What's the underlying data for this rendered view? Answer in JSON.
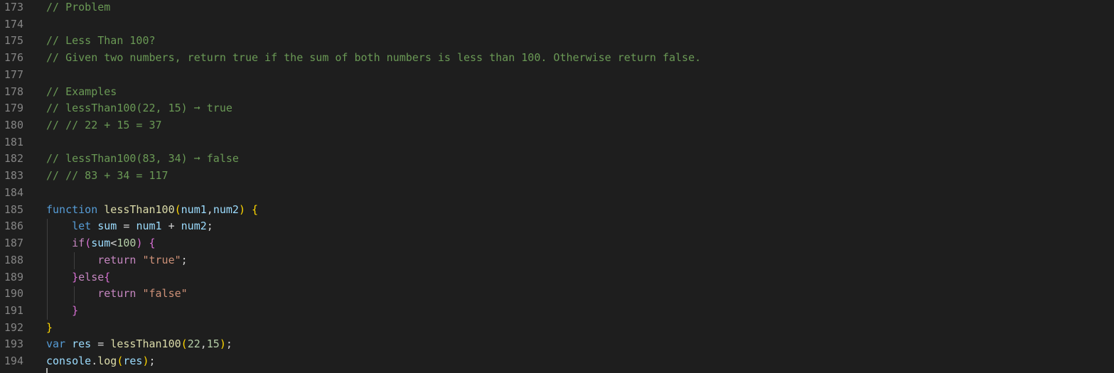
{
  "editor": {
    "lines": [
      {
        "num": "173",
        "tokens": [
          {
            "t": "// Problem",
            "c": "comment"
          }
        ]
      },
      {
        "num": "174",
        "tokens": []
      },
      {
        "num": "175",
        "tokens": [
          {
            "t": "// Less Than 100?",
            "c": "comment"
          }
        ]
      },
      {
        "num": "176",
        "tokens": [
          {
            "t": "// Given two numbers, return true if the sum of both numbers is less than 100. Otherwise return false.",
            "c": "comment"
          }
        ]
      },
      {
        "num": "177",
        "tokens": []
      },
      {
        "num": "178",
        "tokens": [
          {
            "t": "// Examples",
            "c": "comment"
          }
        ]
      },
      {
        "num": "179",
        "tokens": [
          {
            "t": "// lessThan100(22, 15) ➞ true",
            "c": "comment"
          }
        ]
      },
      {
        "num": "180",
        "tokens": [
          {
            "t": "// // 22 + 15 = 37",
            "c": "comment"
          }
        ]
      },
      {
        "num": "181",
        "tokens": []
      },
      {
        "num": "182",
        "tokens": [
          {
            "t": "// lessThan100(83, 34) ➞ false",
            "c": "comment"
          }
        ]
      },
      {
        "num": "183",
        "tokens": [
          {
            "t": "// // 83 + 34 = 117",
            "c": "comment"
          }
        ]
      },
      {
        "num": "184",
        "tokens": []
      },
      {
        "num": "185",
        "tokens": [
          {
            "t": "function",
            "c": "kw"
          },
          {
            "t": " ",
            "c": "plain"
          },
          {
            "t": "lessThan100",
            "c": "fn"
          },
          {
            "t": "(",
            "c": "b1"
          },
          {
            "t": "num1",
            "c": "var"
          },
          {
            "t": ",",
            "c": "plain"
          },
          {
            "t": "num2",
            "c": "var"
          },
          {
            "t": ")",
            "c": "b1"
          },
          {
            "t": " ",
            "c": "plain"
          },
          {
            "t": "{",
            "c": "b1"
          }
        ]
      },
      {
        "num": "186",
        "tokens": [
          {
            "t": "    ",
            "c": "plain"
          },
          {
            "t": "let",
            "c": "kw"
          },
          {
            "t": " ",
            "c": "plain"
          },
          {
            "t": "sum",
            "c": "var"
          },
          {
            "t": " = ",
            "c": "plain"
          },
          {
            "t": "num1",
            "c": "var"
          },
          {
            "t": " + ",
            "c": "plain"
          },
          {
            "t": "num2",
            "c": "var"
          },
          {
            "t": ";",
            "c": "plain"
          }
        ]
      },
      {
        "num": "187",
        "tokens": [
          {
            "t": "    ",
            "c": "plain"
          },
          {
            "t": "if",
            "c": "ctrl"
          },
          {
            "t": "(",
            "c": "b2"
          },
          {
            "t": "sum",
            "c": "var"
          },
          {
            "t": "<",
            "c": "plain"
          },
          {
            "t": "100",
            "c": "num"
          },
          {
            "t": ")",
            "c": "b2"
          },
          {
            "t": " ",
            "c": "plain"
          },
          {
            "t": "{",
            "c": "b2"
          }
        ]
      },
      {
        "num": "188",
        "tokens": [
          {
            "t": "        ",
            "c": "plain"
          },
          {
            "t": "return",
            "c": "ctrl"
          },
          {
            "t": " ",
            "c": "plain"
          },
          {
            "t": "\"true\"",
            "c": "str"
          },
          {
            "t": ";",
            "c": "plain"
          }
        ]
      },
      {
        "num": "189",
        "tokens": [
          {
            "t": "    ",
            "c": "plain"
          },
          {
            "t": "}",
            "c": "b2"
          },
          {
            "t": "else",
            "c": "ctrl"
          },
          {
            "t": "{",
            "c": "b2"
          }
        ]
      },
      {
        "num": "190",
        "tokens": [
          {
            "t": "        ",
            "c": "plain"
          },
          {
            "t": "return",
            "c": "ctrl"
          },
          {
            "t": " ",
            "c": "plain"
          },
          {
            "t": "\"false\"",
            "c": "str"
          }
        ]
      },
      {
        "num": "191",
        "tokens": [
          {
            "t": "    ",
            "c": "plain"
          },
          {
            "t": "}",
            "c": "b2"
          }
        ]
      },
      {
        "num": "192",
        "tokens": [
          {
            "t": "}",
            "c": "b1"
          }
        ]
      },
      {
        "num": "193",
        "tokens": [
          {
            "t": "var",
            "c": "kw"
          },
          {
            "t": " ",
            "c": "plain"
          },
          {
            "t": "res",
            "c": "var"
          },
          {
            "t": " = ",
            "c": "plain"
          },
          {
            "t": "lessThan100",
            "c": "fn"
          },
          {
            "t": "(",
            "c": "b1"
          },
          {
            "t": "22",
            "c": "num"
          },
          {
            "t": ",",
            "c": "plain"
          },
          {
            "t": "15",
            "c": "num"
          },
          {
            "t": ")",
            "c": "b1"
          },
          {
            "t": ";",
            "c": "plain"
          }
        ]
      },
      {
        "num": "194",
        "tokens": [
          {
            "t": "console",
            "c": "var"
          },
          {
            "t": ".",
            "c": "plain"
          },
          {
            "t": "log",
            "c": "fn"
          },
          {
            "t": "(",
            "c": "b1"
          },
          {
            "t": "res",
            "c": "var"
          },
          {
            "t": ")",
            "c": "b1"
          },
          {
            "t": ";",
            "c": "plain"
          }
        ]
      }
    ]
  },
  "colors": {
    "background": "#1e1e1e",
    "line_number": "#858585",
    "comment": "#6a9955",
    "keyword": "#569cd6",
    "control": "#c586c0",
    "function": "#dcdcaa",
    "variable": "#9cdcfe",
    "number": "#b5cea8",
    "string": "#ce9178",
    "bracket_level1": "#ffd700",
    "bracket_level2": "#da70d6"
  }
}
